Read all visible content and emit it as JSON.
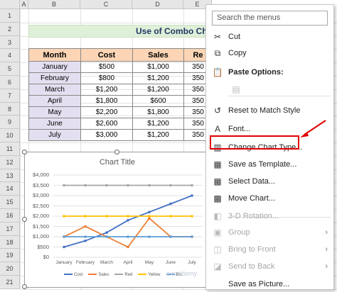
{
  "sheet": {
    "columns": [
      "A",
      "B",
      "C",
      "D",
      "E"
    ],
    "rows": [
      "1",
      "2",
      "3",
      "4",
      "5",
      "6",
      "7",
      "8",
      "9",
      "10",
      "11",
      "12",
      "13",
      "14",
      "15",
      "16",
      "17",
      "18",
      "19",
      "20",
      "21"
    ],
    "title_text": "Use of Combo Ch",
    "table": {
      "headers": [
        "Month",
        "Cost",
        "Sales",
        "Re"
      ],
      "rows": [
        [
          "January",
          "$500",
          "$1,000",
          "350"
        ],
        [
          "February",
          "$800",
          "$1,200",
          "350"
        ],
        [
          "March",
          "$1,200",
          "$1,200",
          "350"
        ],
        [
          "April",
          "$1,800",
          "$600",
          "350"
        ],
        [
          "May",
          "$2,200",
          "$1,800",
          "350"
        ],
        [
          "June",
          "$2,600",
          "$1,200",
          "350"
        ],
        [
          "July",
          "$3,000",
          "$1,200",
          "350"
        ]
      ]
    }
  },
  "chart_data": {
    "type": "line",
    "title": "Chart Title",
    "categories": [
      "January",
      "February",
      "March",
      "April",
      "May",
      "June",
      "July"
    ],
    "ylim": [
      0,
      4000
    ],
    "yticks": [
      "$4,000",
      "$3,500",
      "$3,000",
      "$2,500",
      "$2,000",
      "$1,500",
      "$1,000",
      "$500",
      "$0"
    ],
    "series": [
      {
        "name": "Cost",
        "color": "#4472c4",
        "values": [
          500,
          800,
          1200,
          1800,
          2200,
          2600,
          3000
        ]
      },
      {
        "name": "Sales",
        "color": "#ed7d31",
        "values": [
          1000,
          1500,
          1000,
          500,
          1900,
          1000,
          1000
        ]
      },
      {
        "name": "Red",
        "color": "#a5a5a5",
        "values": [
          3500,
          3500,
          3500,
          3500,
          3500,
          3500,
          3500
        ]
      },
      {
        "name": "Yellow",
        "color": "#ffc000",
        "values": [
          2000,
          2000,
          2000,
          2000,
          2000,
          2000,
          2000
        ]
      },
      {
        "name": "Blu",
        "color": "#5b9bd5",
        "values": [
          1000,
          1000,
          1000,
          1000,
          1000,
          1000,
          1000
        ]
      }
    ],
    "grid": true,
    "legend": "bottom"
  },
  "context_menu": {
    "search_placeholder": "Search the menus",
    "items": [
      {
        "label": "Cut",
        "icon": "scissors-icon",
        "glyph": "✂",
        "enabled": true
      },
      {
        "label": "Copy",
        "icon": "copy-icon",
        "glyph": "⧉",
        "enabled": true
      },
      {
        "label": "Paste Options:",
        "icon": "paste-icon",
        "glyph": "📋",
        "enabled": true
      },
      {
        "label": "",
        "icon": "paste-option-icon",
        "glyph": "▤",
        "enabled": false
      },
      {
        "label": "Reset to Match Style",
        "icon": "reset-style-icon",
        "glyph": "↺",
        "enabled": true
      },
      {
        "label": "Font...",
        "icon": "font-icon",
        "glyph": "A",
        "enabled": true
      },
      {
        "label": "Change Chart Type...",
        "icon": "change-chart-type-icon",
        "glyph": "▥",
        "enabled": true
      },
      {
        "label": "Save as Template...",
        "icon": "save-template-icon",
        "glyph": "▦",
        "enabled": true
      },
      {
        "label": "Select Data...",
        "icon": "select-data-icon",
        "glyph": "▦",
        "enabled": true
      },
      {
        "label": "Move Chart...",
        "icon": "move-chart-icon",
        "glyph": "▩",
        "enabled": true
      },
      {
        "label": "3-D Rotation...",
        "icon": "3d-rotation-icon",
        "glyph": "◧",
        "enabled": false
      },
      {
        "label": "Group",
        "icon": "group-icon",
        "glyph": "▣",
        "enabled": false,
        "submenu": true
      },
      {
        "label": "Bring to Front",
        "icon": "bring-front-icon",
        "glyph": "◫",
        "enabled": false,
        "submenu": true
      },
      {
        "label": "Send to Back",
        "icon": "send-back-icon",
        "glyph": "◪",
        "enabled": false,
        "submenu": true
      },
      {
        "label": "Save as Picture...",
        "icon": "save-picture-icon",
        "glyph": "",
        "enabled": true
      }
    ]
  },
  "colors": {
    "highlight": "#e00000",
    "title_band": "#dff0d8",
    "header_fill": "#fbd5b5",
    "month_fill": "#e4dff0"
  }
}
